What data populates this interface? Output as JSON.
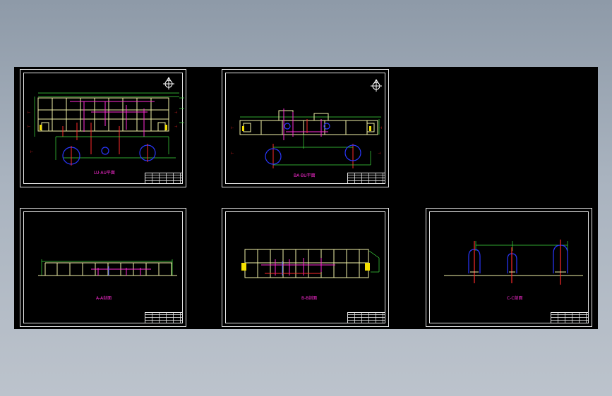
{
  "sheets": {
    "plan_1": {
      "title": "LU·AU平面"
    },
    "plan_2": {
      "title": "BA·BU平面"
    },
    "section_a": {
      "title": "A-A剖面"
    },
    "section_b": {
      "title": "B-B剖面"
    },
    "section_c": {
      "title": "C-C剖面"
    }
  },
  "colors": {
    "background_top": "#8e9aa8",
    "background_bottom": "#bcc3cc",
    "model_space": "#000000",
    "frame": "#e8e8e8",
    "wall": "#f2f2a8",
    "pipe_magenta": "#ff2bd6",
    "pipe_blue": "#2a37ff",
    "pipe_red": "#ff2a2a",
    "dim_green": "#3fe03f",
    "fill_yellow": "#f5e000"
  },
  "icons": [
    "north-arrow-icon",
    "north-arrow-icon"
  ]
}
